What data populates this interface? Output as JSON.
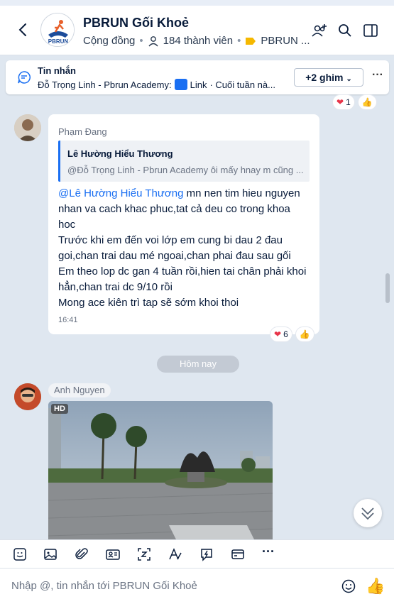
{
  "header": {
    "group_name": "PBRUN Gối Khoẻ",
    "group_type": "Cộng đồng",
    "member_count": "184 thành viên",
    "tag_label": "PBRUN ...",
    "logo_text": "PBRUN"
  },
  "pinned": {
    "title": "Tin nhắn",
    "sender": "Đỗ Trọng Linh - Pbrun Academy:",
    "link_label": "Link",
    "text": "· Cuối tuần nà...",
    "more_pins_label": "+2 ghim"
  },
  "reactions_top": {
    "heart_count": "1"
  },
  "message1": {
    "sender": "Phạm Đang",
    "quote_name": "Lê Hường Hiểu Thương",
    "quote_text": "@Đỗ Trọng Linh - Pbrun Academy ôi mấy hnay m cũng ...",
    "mention": "@Lê Hường Hiểu Thương",
    "line1": " mn nen tim hieu nguyen nhan va cach khac phuc,tat cả deu co trong khoa hoc",
    "line2": "Trước khi em đến voi lớp em cung bi dau 2 đau goi,chan trai dau mé ngoai,chan phai đau sau gối",
    "line3": "Em theo lop dc gan 4 tuần rồi,hien tai chân phải khoi hẳn,chan trai dc 9/10 rồi",
    "line4": "Mong ace kiên trì tap sẽ sớm khoi thoi",
    "time": "16:41",
    "heart_count": "6"
  },
  "date_separator": "Hôm nay",
  "message2": {
    "sender": "Anh Nguyen",
    "hd_badge": "HD"
  },
  "composer": {
    "placeholder": "Nhập @, tin nhắn tới PBRUN Gối Khoẻ"
  },
  "colors": {
    "accent": "#1a6ff2",
    "background": "#dfe7f0",
    "heart": "#e8364a"
  }
}
